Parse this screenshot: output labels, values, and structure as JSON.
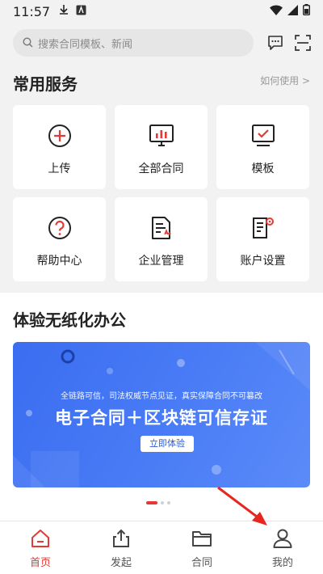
{
  "status_bar": {
    "time": "11:57"
  },
  "search": {
    "placeholder": "搜索合同模板、新闻"
  },
  "services": {
    "title": "常用服务",
    "howto": "如何使用 >",
    "items": [
      {
        "label": "上传",
        "icon": "plus-circle-icon"
      },
      {
        "label": "全部合同",
        "icon": "chart-monitor-icon"
      },
      {
        "label": "模板",
        "icon": "check-monitor-icon"
      },
      {
        "label": "帮助中心",
        "icon": "question-circle-icon"
      },
      {
        "label": "企业管理",
        "icon": "document-icon"
      },
      {
        "label": "账户设置",
        "icon": "settings-document-icon"
      }
    ]
  },
  "promo": {
    "title": "体验无纸化办公",
    "banner_small": "全链路可信，司法权威节点见证，真实保障合同不可篡改",
    "banner_big": "电子合同＋区块链可信存证",
    "banner_cta": "立即体验"
  },
  "bottom_nav": {
    "items": [
      {
        "label": "首页",
        "icon": "home-icon",
        "active": true
      },
      {
        "label": "发起",
        "icon": "share-upload-icon"
      },
      {
        "label": "合同",
        "icon": "folder-icon"
      },
      {
        "label": "我的",
        "icon": "user-icon"
      }
    ]
  },
  "colors": {
    "accent": "#e53935",
    "banner_blue": "#4a7cf6",
    "card_bg": "#ffffff",
    "page_bg": "#f2f2f2"
  }
}
